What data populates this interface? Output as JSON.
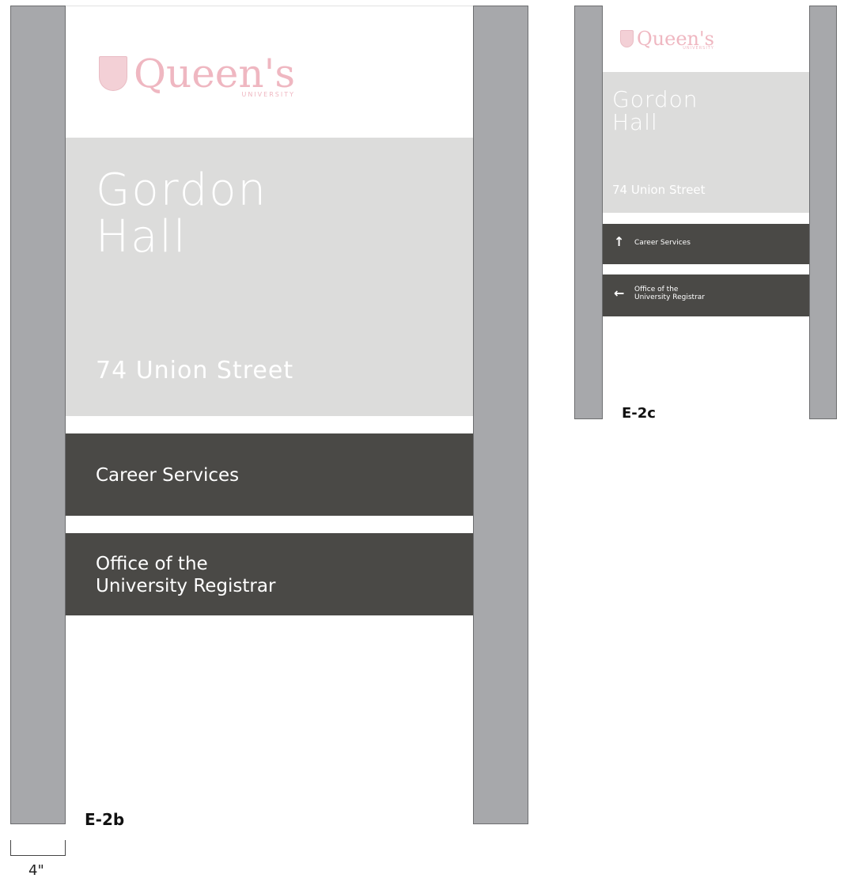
{
  "colors": {
    "post": "#a7a8ab",
    "name_block": "#dcdcdb",
    "directory_block": "#4a4946",
    "logo": "#efb7c1"
  },
  "logo": {
    "wordmark": "Queen's",
    "subtext": "UNIVERSITY",
    "icon": "crest-icon"
  },
  "sign_e2b": {
    "label": "E-2b",
    "building_name": "Gordon\nHall",
    "address": "74 Union Street",
    "directory": [
      {
        "text": "Career Services",
        "arrow": ""
      },
      {
        "text": "Office of the\nUniversity Registrar",
        "arrow": ""
      }
    ]
  },
  "sign_e2c": {
    "label": "E-2c",
    "building_name": "Gordon\nHall",
    "address": "74 Union Street",
    "directory": [
      {
        "text": "Career Services",
        "arrow": "↑"
      },
      {
        "text": "Office of the\nUniversity Registrar",
        "arrow": "←"
      }
    ]
  },
  "scale": {
    "label": "4\""
  }
}
